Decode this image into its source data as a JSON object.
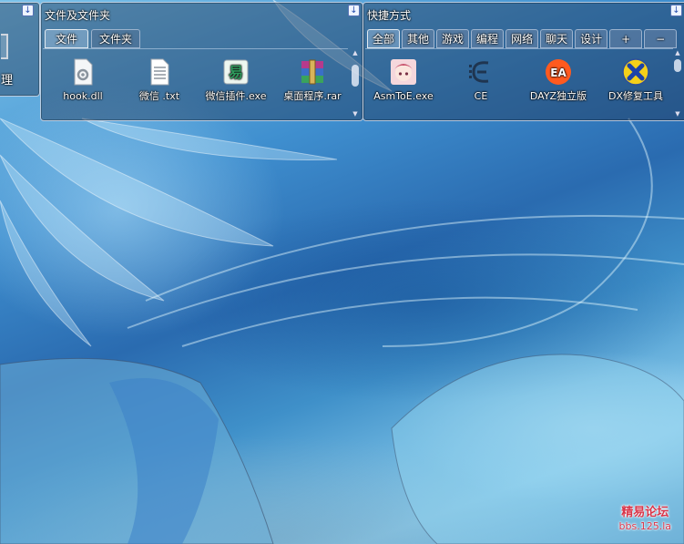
{
  "left_fence": {
    "label": "理"
  },
  "files_fence": {
    "title": "文件及文件夹",
    "tabs": [
      {
        "label": "文件"
      },
      {
        "label": "文件夹"
      }
    ],
    "items": [
      {
        "label": "hook.dll",
        "icon": "dll-file-icon"
      },
      {
        "label": "微信 .txt",
        "icon": "text-file-icon"
      },
      {
        "label": "微信插件.exe",
        "icon": "exe-file-icon"
      },
      {
        "label": "桌面程序.rar",
        "icon": "rar-archive-icon"
      }
    ]
  },
  "shortcut_fence": {
    "title": "快捷方式",
    "tabs": [
      {
        "label": "全部"
      },
      {
        "label": "其他"
      },
      {
        "label": "游戏"
      },
      {
        "label": "编程"
      },
      {
        "label": "网络"
      },
      {
        "label": "聊天"
      },
      {
        "label": "设计"
      },
      {
        "label": "+"
      },
      {
        "label": "−"
      }
    ],
    "items": [
      {
        "label": "AsmToE.exe",
        "icon": "anime-avatar-icon"
      },
      {
        "label": "CE",
        "icon": "cheat-engine-icon"
      },
      {
        "label": "DAYZ独立版",
        "icon": "ea-app-icon"
      },
      {
        "label": "DX修复工具",
        "icon": "directx-repair-icon"
      }
    ]
  },
  "watermark": {
    "line1": "精易论坛",
    "line2": "bbs.125.la"
  },
  "colors": {
    "fence_bg": "#1c304e",
    "accent_blue": "#2f54b0",
    "ea_orange": "#ff5a1f",
    "watermark_red": "#d9364a"
  }
}
